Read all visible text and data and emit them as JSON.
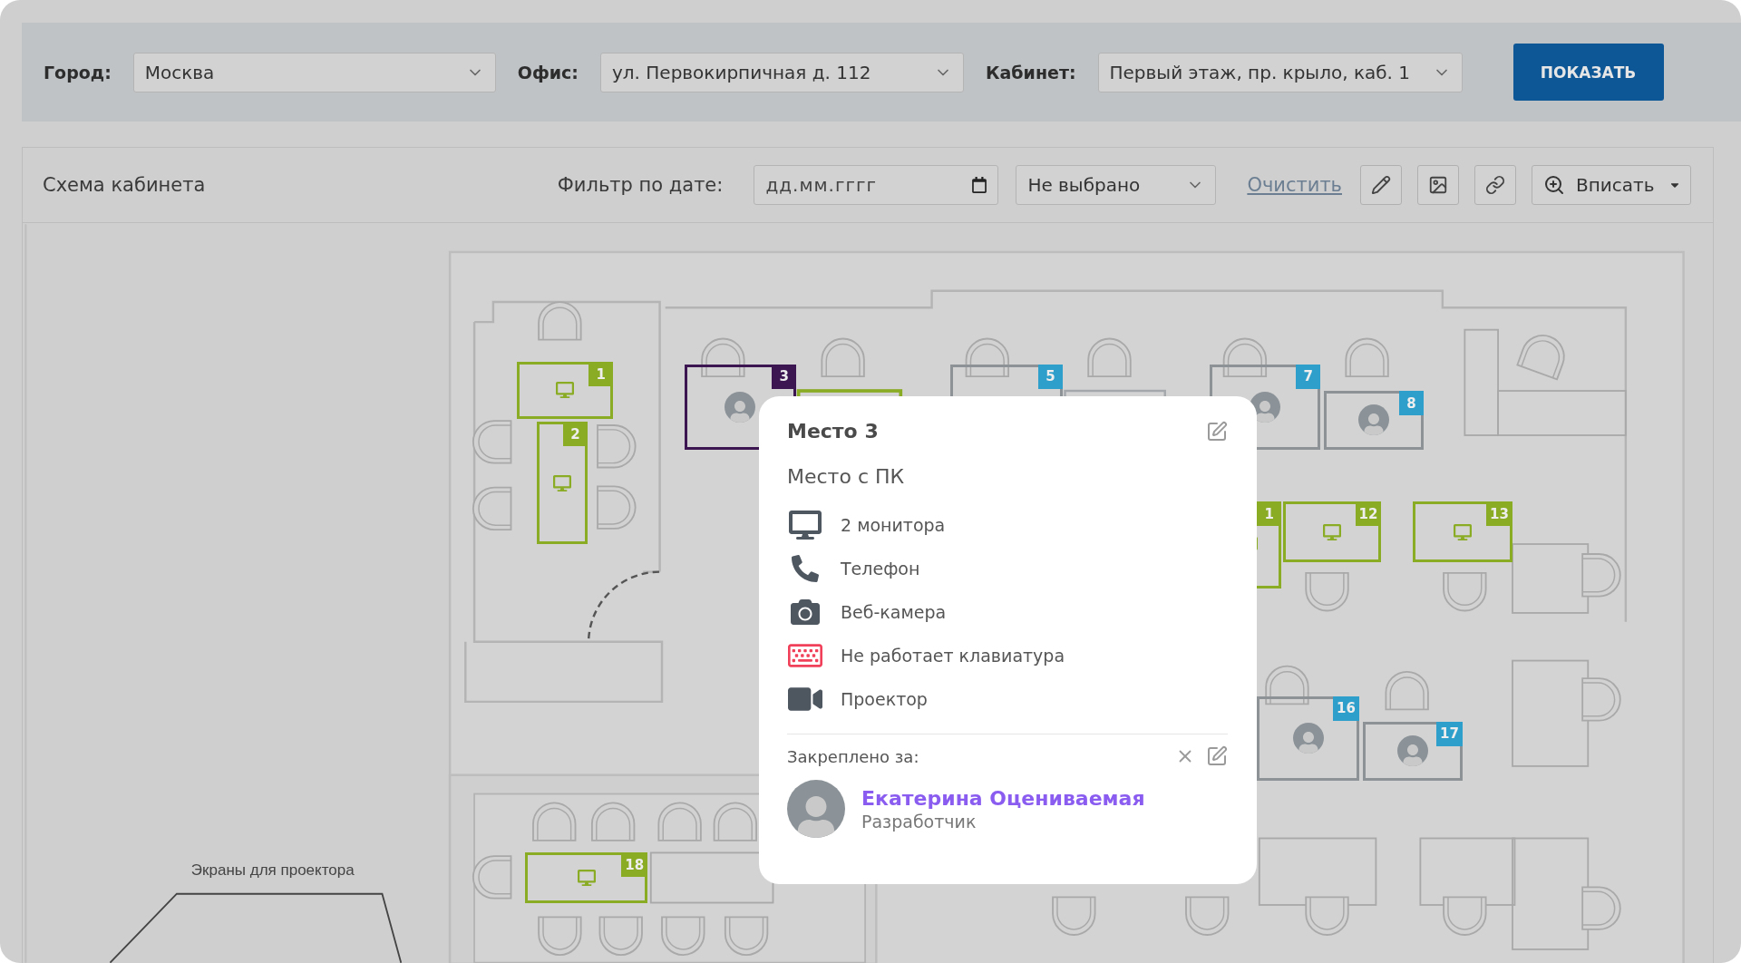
{
  "filters": [
    {
      "label": "Город:",
      "value": "Москва"
    },
    {
      "label": "Офис:",
      "value": "ул. Первокирпичная д. 112"
    },
    {
      "label": "Кабинет:",
      "value": "Первый этаж, пр. крыло, каб. 1"
    }
  ],
  "show_button": "ПОКАЗАТЬ",
  "panel": {
    "title": "Схема кабинета",
    "date_filter": {
      "label": "Фильтр по дате:",
      "placeholder": "дд.мм.гггг"
    },
    "status_select": "Не выбрано",
    "clear_link": "Очистить",
    "fit_button": "Вписать"
  },
  "plan": {
    "caption": "Экраны для проектора",
    "seats": [
      {
        "number": "1",
        "available": true,
        "selected": false,
        "avatar": false
      },
      {
        "number": "2",
        "available": true,
        "selected": false,
        "avatar": false
      },
      {
        "number": "3",
        "available": false,
        "selected": true,
        "avatar": true
      },
      {
        "number": "5",
        "available": false,
        "selected": false,
        "avatar": false
      },
      {
        "number": "7",
        "available": false,
        "selected": false,
        "avatar": true
      },
      {
        "number": "8",
        "available": false,
        "selected": false,
        "avatar": true
      },
      {
        "number": "1",
        "available": true,
        "selected": false,
        "avatar": false
      },
      {
        "number": "12",
        "available": true,
        "selected": false,
        "avatar": false
      },
      {
        "number": "13",
        "available": true,
        "selected": false,
        "avatar": false
      },
      {
        "number": "16",
        "available": false,
        "selected": false,
        "avatar": true
      },
      {
        "number": "17",
        "available": false,
        "selected": false,
        "avatar": true
      },
      {
        "number": "18",
        "available": true,
        "selected": false,
        "avatar": false
      }
    ]
  },
  "popup": {
    "title": "Место 3",
    "subtitle": "Место с ПК",
    "features": [
      {
        "kind": "monitor",
        "label": "2 монитора",
        "broken": false
      },
      {
        "kind": "phone",
        "label": "Телефон",
        "broken": false
      },
      {
        "kind": "camera",
        "label": "Веб-камера",
        "broken": false
      },
      {
        "kind": "keyboard",
        "label": "Не работает клавиатура",
        "broken": true
      },
      {
        "kind": "projector",
        "label": "Проектор",
        "broken": false
      }
    ],
    "assigned_label": "Закреплено за:",
    "person": {
      "name": "Екатерина Оцениваемая",
      "role": "Разработчик"
    }
  }
}
